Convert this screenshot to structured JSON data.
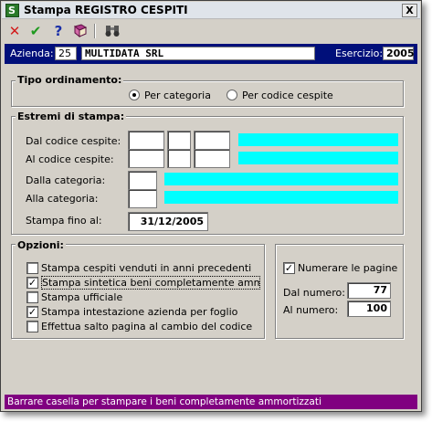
{
  "window": {
    "title": "Stampa REGISTRO CESPITI",
    "app_icon": "S",
    "close_glyph": "X"
  },
  "toolbar": {
    "cancel_icon": "x-icon",
    "confirm_icon": "check-icon",
    "help_icon": "question-icon",
    "book_icon": "book-icon",
    "binoculars_icon": "binoculars-icon"
  },
  "infobar": {
    "azienda_label": "Azienda:",
    "azienda_code": "25",
    "azienda_name": "MULTIDATA SRL",
    "esercizio_label": "Esercizio:",
    "esercizio_value": "2005"
  },
  "ordinamento": {
    "title": "Tipo ordinamento:",
    "option_categoria": "Per categoria",
    "option_codice": "Per codice cespite",
    "selected": "categoria"
  },
  "estremi": {
    "title": "Estremi di stampa:",
    "dal_codice_label": "Dal codice cespite:",
    "al_codice_label": "Al codice cespite:",
    "dalla_categoria_label": "Dalla categoria:",
    "alla_categoria_label": "Alla categoria:",
    "stampa_fino_label": "Stampa fino al:",
    "stampa_fino_value": "31/12/2005"
  },
  "opzioni": {
    "title": "Opzioni:",
    "items": [
      {
        "label": "Stampa cespiti venduti in anni precedenti",
        "checked": false
      },
      {
        "label": "Stampa sintetica beni completamente ammortizzati",
        "checked": true
      },
      {
        "label": "Stampa ufficiale",
        "checked": false
      },
      {
        "label": "Stampa intestazione azienda per foglio",
        "checked": true
      },
      {
        "label": "Effettua salto pagina al cambio del codice",
        "checked": false
      }
    ]
  },
  "pagine": {
    "numerare_label": "Numerare le pagine",
    "numerare_checked": true,
    "dal_label": "Dal numero:",
    "dal_value": "77",
    "al_label": "Al numero:",
    "al_value": "100"
  },
  "status": {
    "text": "Barrare casella per stampare i beni completamente ammortizzati"
  },
  "colors": {
    "infobar": "#000f7a",
    "cyan_field": "#00ffff",
    "statusbar": "#800080",
    "dialog": "#d4d0c8"
  }
}
